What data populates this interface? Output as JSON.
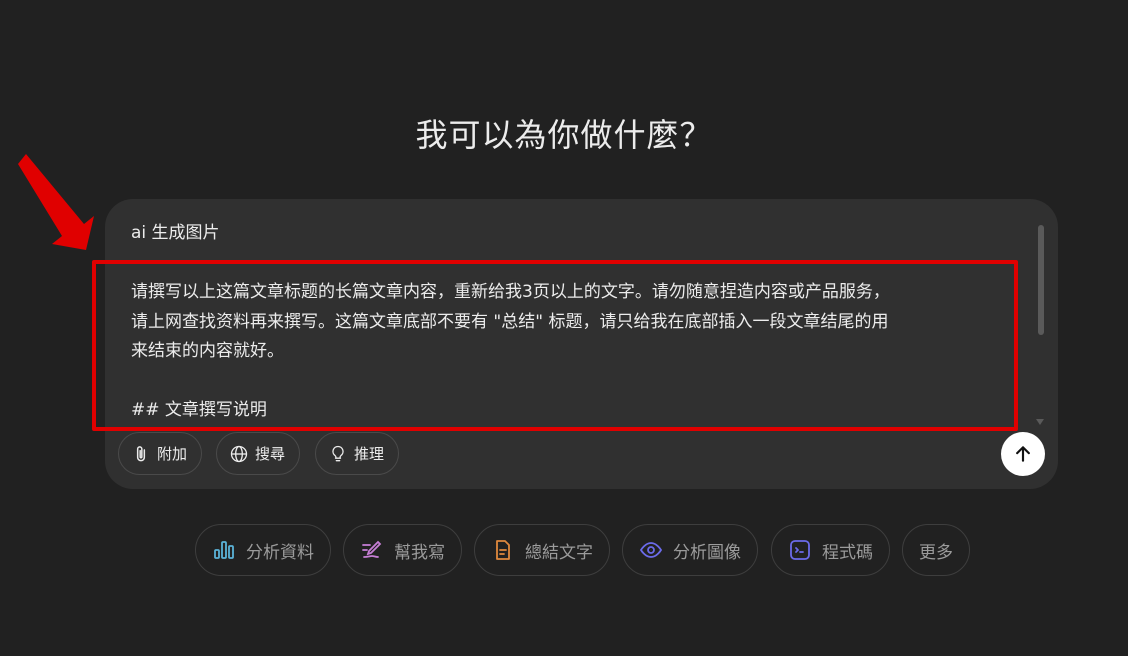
{
  "heading": "我可以為你做什麼？",
  "composer": {
    "lines": {
      "l1": "ai 生成图片",
      "l2": "请撰写以上这篇文章标题的长篇文章内容，重新给我3页以上的文字。请勿随意捏造内容或产品服务，",
      "l3": "请上网查找资料再来撰写。这篇文章底部不要有 \"总结\" 标题，请只给我在底部插入一段文章结尾的用",
      "l4": "来结束的内容就好。",
      "l5": "## 文章撰写说明"
    },
    "tools": {
      "attach": "附加",
      "search": "搜尋",
      "reason": "推理"
    }
  },
  "suggestions": {
    "analyze_data": "分析資料",
    "help_write": "幫我寫",
    "summarize_text": "總結文字",
    "analyze_image": "分析圖像",
    "code": "程式碼",
    "more": "更多"
  },
  "colors": {
    "background": "#212121",
    "composer": "#303030",
    "highlight": "#e00000",
    "chart_icon": "#5bb3d8",
    "pen_icon": "#c77fd6",
    "doc_icon": "#e0893e",
    "eye_icon": "#6b6bea",
    "terminal_icon": "#6b6bea"
  }
}
